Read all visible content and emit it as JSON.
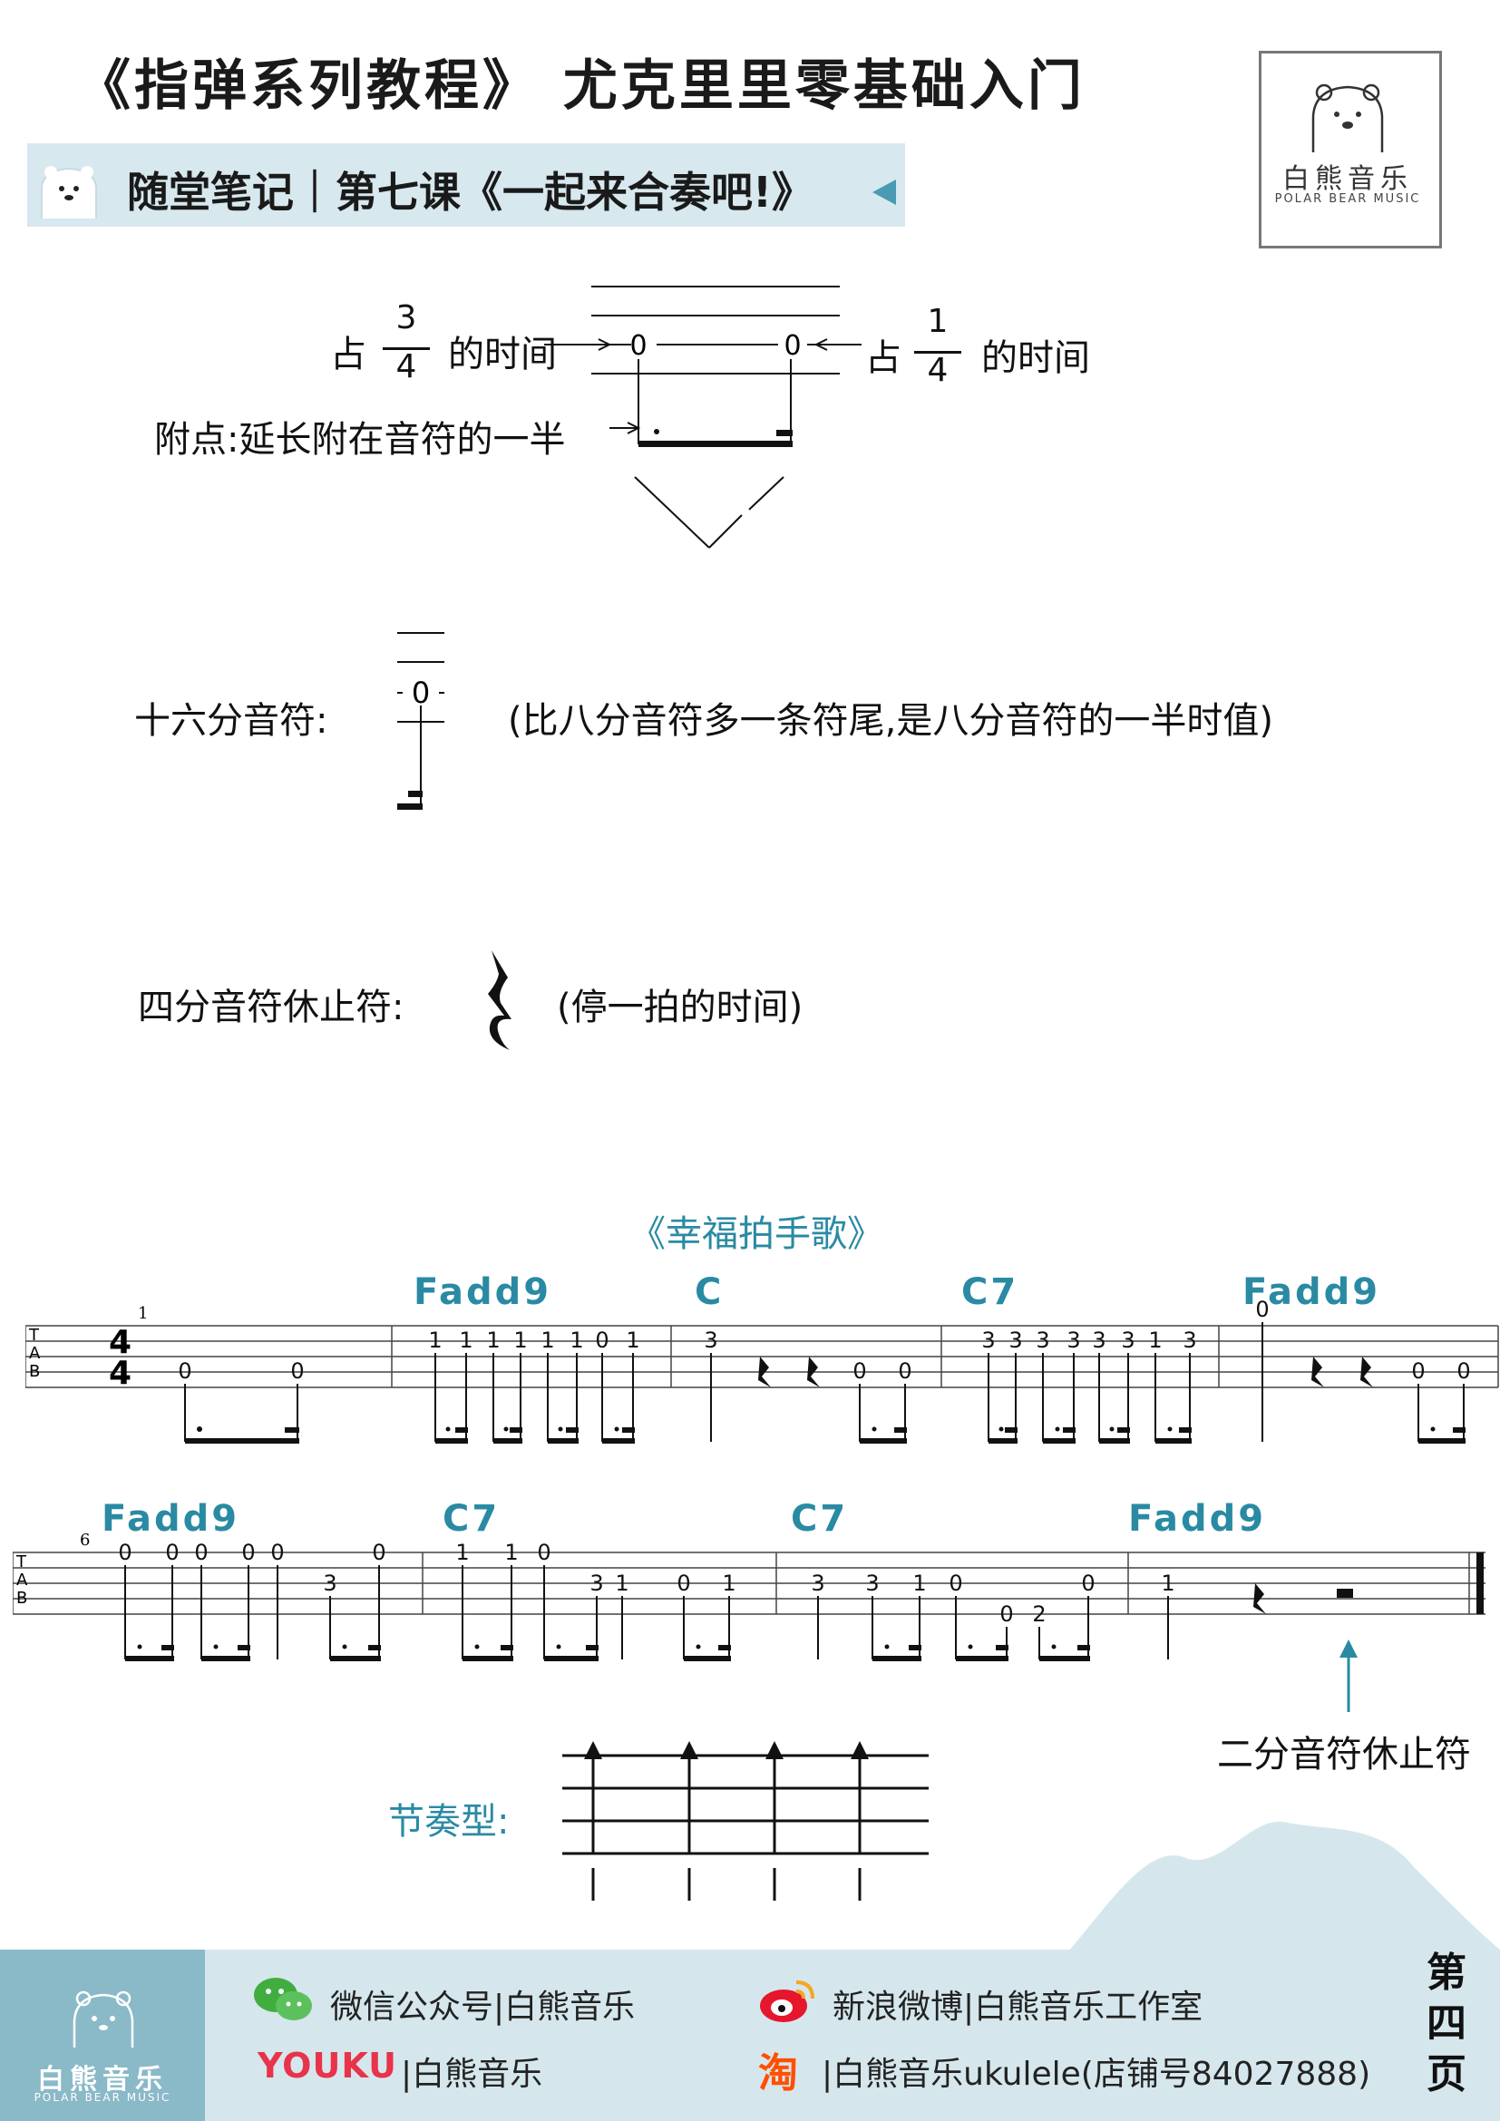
{
  "header": {
    "title": "《指弹系列教程》 尤克里里零基础入门",
    "subtitle": "随堂笔记｜第七课《一起来合奏吧!》"
  },
  "logo": {
    "name_cn": "白熊音乐",
    "name_en": "POLAR BEAR MUSIC"
  },
  "notes": {
    "dotted_left_prefix": "占",
    "dotted_left_num": "3",
    "dotted_left_den": "4",
    "dotted_left_suffix": "的时间",
    "dotted_right_prefix": "占",
    "dotted_right_num": "1",
    "dotted_right_den": "4",
    "dotted_right_suffix": "的时间",
    "dot_label": "附点:延长附在音符的一半",
    "sixteenth_label": "十六分音符:",
    "sixteenth_desc": "(比八分音符多一条符尾,是八分音符的一半时值)",
    "quarter_rest_label": "四分音符休止符:",
    "quarter_rest_desc": "(停一拍的时间)",
    "half_rest_label": "二分音符休止符"
  },
  "song": {
    "title": "《幸福拍手歌》",
    "time_signature": "4/4",
    "row1_measure_number": "1",
    "row2_measure_number": "6",
    "row1_chords": [
      "Fadd9",
      "C",
      "C7",
      "Fadd9"
    ],
    "row2_chords": [
      "Fadd9",
      "C7",
      "C7",
      "Fadd9"
    ],
    "tab_letters": [
      "T",
      "A",
      "B"
    ]
  },
  "rhythm": {
    "label": "节奏型:"
  },
  "footer": {
    "wechat": "微信公众号|白熊音乐",
    "weibo": "新浪微博|白熊音乐工作室",
    "youku_brand": "YOUKU",
    "youku": "|白熊音乐",
    "taobao_brand": "淘",
    "taobao": "|白熊音乐ukulele(店铺号84027888)",
    "page": "第四页",
    "page_chars": [
      "第",
      "四",
      "页"
    ]
  },
  "colors": {
    "accent": "#2a8aa3",
    "banner": "#d7e8ee",
    "footer": "#d5e7ec",
    "footer_dark": "#8ab9c8"
  }
}
